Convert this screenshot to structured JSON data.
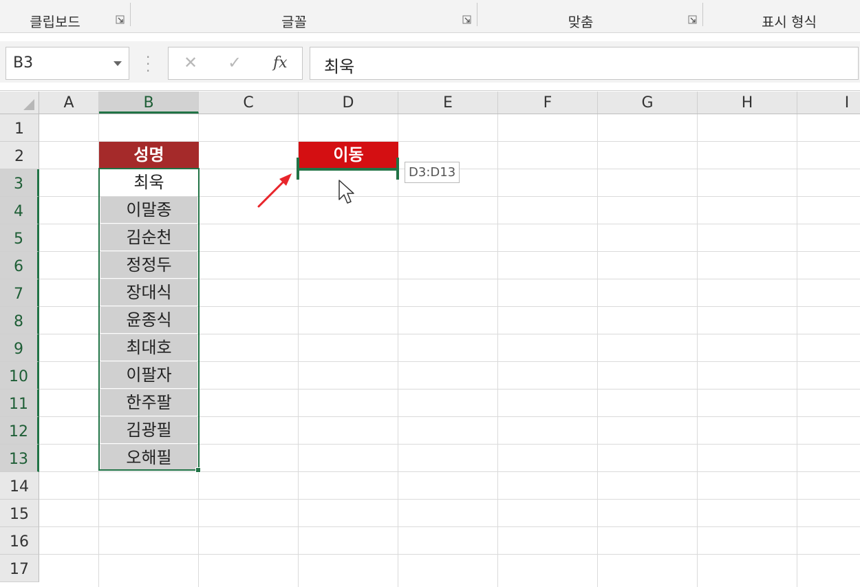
{
  "ribbon": {
    "groups": [
      {
        "label": "클립보드"
      },
      {
        "label": "글꼴"
      },
      {
        "label": "맞춤"
      },
      {
        "label": "표시 형식"
      }
    ]
  },
  "formula_bar": {
    "name_box": "B3",
    "formula": "최욱"
  },
  "columns": [
    "A",
    "B",
    "C",
    "D",
    "E",
    "F",
    "G",
    "H",
    "I"
  ],
  "rows": [
    "1",
    "2",
    "3",
    "4",
    "5",
    "6",
    "7",
    "8",
    "9",
    "10",
    "11",
    "12",
    "13",
    "14",
    "15",
    "16",
    "17"
  ],
  "cells": {
    "B2": "성명",
    "D2": "이동",
    "names": [
      "최욱",
      "이말종",
      "김순천",
      "정정두",
      "장대식",
      "윤종식",
      "최대호",
      "이팔자",
      "한주팔",
      "김광필",
      "오해필"
    ]
  },
  "drag_tooltip": "D3:D13",
  "colors": {
    "selection": "#217346",
    "header_b": "#a52a2a",
    "header_d": "#d40f12",
    "gray_fill": "#d0d0d0",
    "arrow": "#e8252b"
  }
}
